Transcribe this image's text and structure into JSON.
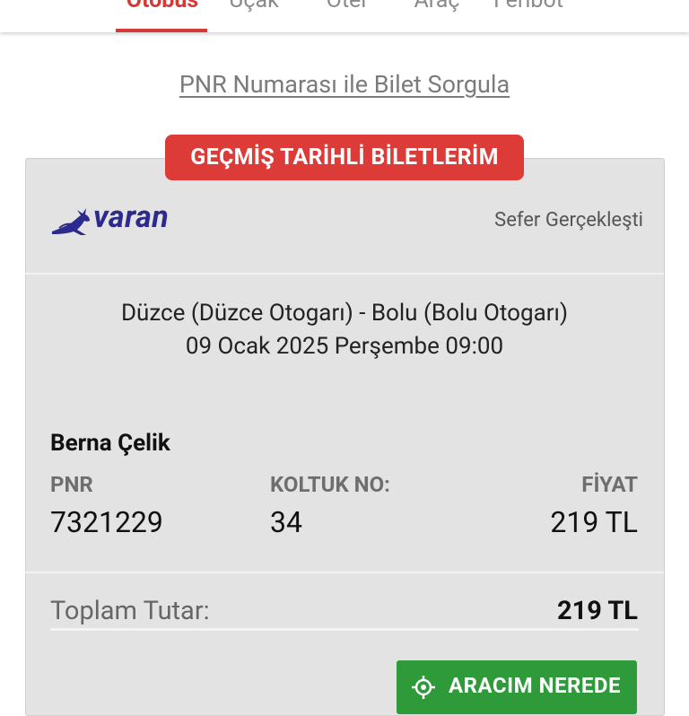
{
  "tabs": [
    {
      "label": "Otobüs",
      "active": true
    },
    {
      "label": "Uçak",
      "active": false
    },
    {
      "label": "Otel",
      "active": false
    },
    {
      "label": "Araç",
      "active": false
    },
    {
      "label": "Feribot",
      "active": false
    }
  ],
  "pnr_link": "PNR Numarası ile Bilet Sorgula",
  "section_badge": "GEÇMİŞ TARİHLİ BİLETLERİM",
  "ticket": {
    "company": "varan",
    "status": "Sefer Gerçekleşti",
    "route": "Düzce (Düzce Otogarı) - Bolu (Bolu Otogarı)",
    "datetime": "09 Ocak 2025 Perşembe 09:00",
    "passenger": "Berna Çelik",
    "pnr_label": "PNR",
    "pnr_value": "7321229",
    "seat_label": "KOLTUK NO:",
    "seat_value": "34",
    "price_label": "FİYAT",
    "price_value": "219 TL",
    "total_label": "Toplam Tutar:",
    "total_value": "219 TL",
    "where_button": "ARACIM NEREDE"
  },
  "colors": {
    "accent_red": "#d63a36",
    "badge_red": "#dc3b37",
    "button_green": "#2e9a3a",
    "card_bg": "#e3e3e3",
    "logo_blue": "#2c2a8c"
  },
  "icons": {
    "logo": "varan-deer-logo",
    "where_button": "location-target-icon"
  }
}
